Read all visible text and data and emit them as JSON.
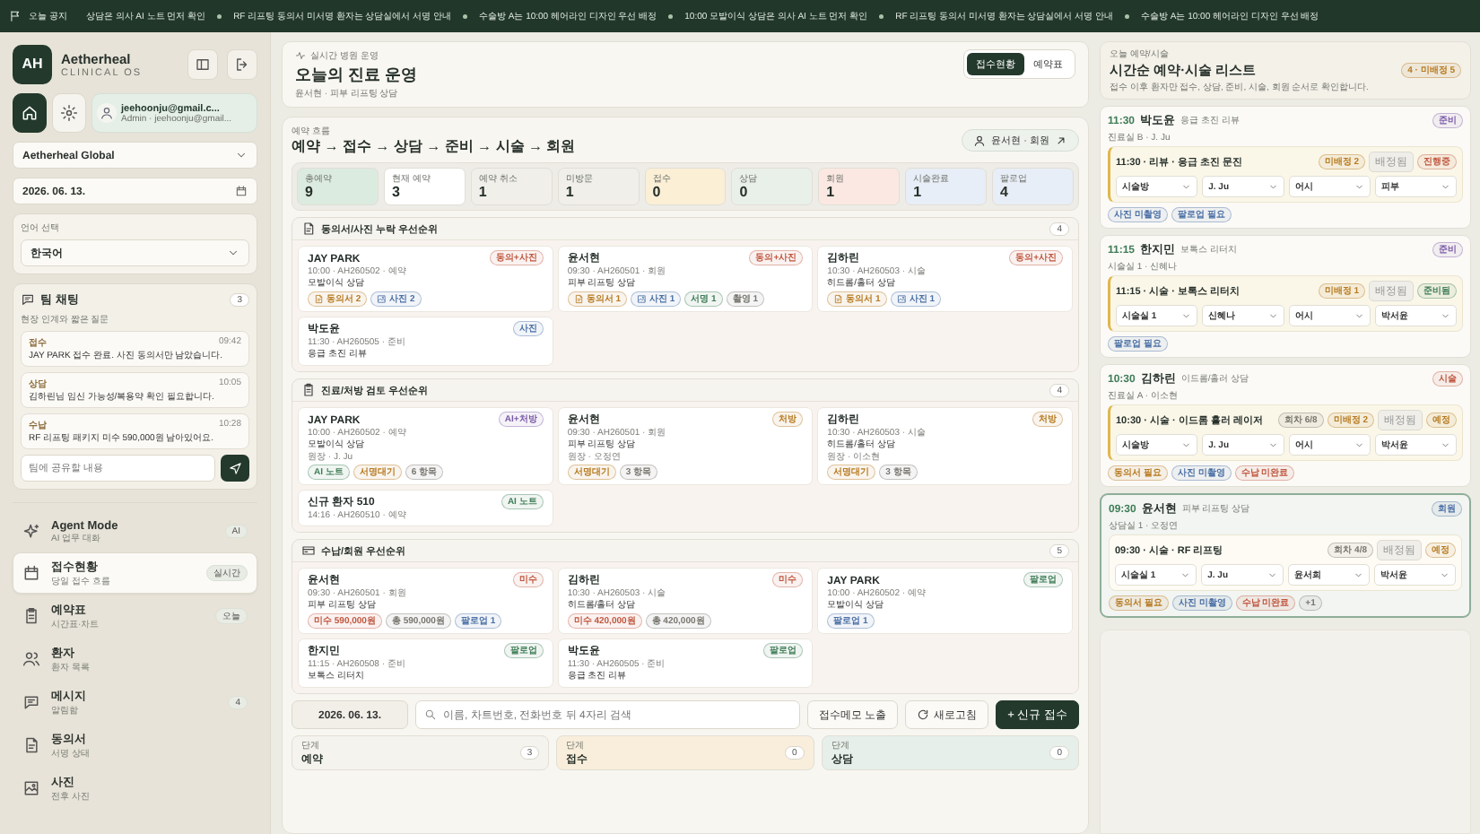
{
  "ticker": {
    "label": "오늘 공지",
    "items": [
      "상담은 의사 AI 노트 먼저 확인",
      "RF 리프팅 동의서 미서명 환자는 상담실에서 서명 안내",
      "수술방 A는 10:00 헤어라인 디자인 우선 배정",
      "10:00 모발이식 상담은 의사 AI 노트 먼저 확인",
      "RF 리프팅 동의서 미서명 환자는 상담실에서 서명 안내",
      "수술방 A는 10:00 헤어라인 디자인 우선 배정"
    ]
  },
  "sidebar": {
    "brand": {
      "mark": "AH",
      "name": "Aetherheal",
      "tagline": "CLINICAL OS"
    },
    "quick_buttons": [
      {
        "kind": "home",
        "selected": true
      },
      {
        "kind": "settings",
        "selected": false
      }
    ],
    "user": {
      "email": "jeehoonju@gmail.c...",
      "role": "Admin · jeehoonju@gmail..."
    },
    "clinic": "Aetherheal Global",
    "date": "2026. 06. 13.",
    "language": {
      "label": "언어 선택",
      "value": "한국어"
    },
    "team_chat": {
      "title": "팀 채팅",
      "count": "3",
      "subtitle": "현장 인계와 짧은 질문",
      "placeholder": "팀에 공유할 내용",
      "messages": [
        {
          "role": "접수",
          "time": "09:42",
          "text": "JAY PARK 접수 완료. 사진 동의서만 남았습니다."
        },
        {
          "role": "상담",
          "time": "10:05",
          "text": "김하린님 임신 가능성/복용약 확인 필요합니다."
        },
        {
          "role": "수납",
          "time": "10:28",
          "text": "RF 리프팅 패키지 미수 590,000원 남아있어요."
        }
      ]
    },
    "nav": [
      {
        "kind": "agent",
        "title": "Agent Mode",
        "subtitle": "AI 업무 대화",
        "badge": "AI",
        "selected": false
      },
      {
        "kind": "reception",
        "title": "접수현황",
        "subtitle": "당일 접수 흐름",
        "badge": "실시간",
        "selected": true
      },
      {
        "kind": "schedule",
        "title": "예약표",
        "subtitle": "시간표·차트",
        "badge": "오늘",
        "selected": false
      },
      {
        "kind": "patients",
        "title": "환자",
        "subtitle": "환자 목록",
        "selected": false
      },
      {
        "kind": "messages",
        "title": "메시지",
        "subtitle": "알림함",
        "badge": "4",
        "selected": false
      },
      {
        "kind": "consent",
        "title": "동의서",
        "subtitle": "서명 상태",
        "selected": false
      },
      {
        "kind": "photos",
        "title": "사진",
        "subtitle": "전후 사진",
        "selected": false
      }
    ]
  },
  "main": {
    "header": {
      "eyebrow": "실시간 병원 운영",
      "title": "오늘의 진료 운영",
      "subtitle": "윤서현 · 피부 리프팅 상담",
      "views": [
        {
          "label": "접수현황",
          "selected": true
        },
        {
          "label": "예약표",
          "selected": false
        }
      ]
    },
    "flow": {
      "eyebrow": "예약 흐름",
      "title": "예약 → 접수 → 상담 → 준비 → 시술 → 회원",
      "action": "윤서현 · 회원",
      "stats": [
        {
          "label": "총예약",
          "value": "9",
          "color": "#dcebdf"
        },
        {
          "label": "현재 예약",
          "value": "3",
          "color": "#ffffff"
        },
        {
          "label": "예약 취소",
          "value": "1",
          "color": "#f0efea"
        },
        {
          "label": "미방문",
          "value": "1",
          "color": "#f0efea"
        },
        {
          "label": "접수",
          "value": "0",
          "color": "#fbefd6"
        },
        {
          "label": "상담",
          "value": "0",
          "color": "#e9efe9"
        },
        {
          "label": "회원",
          "value": "1",
          "color": "#fbe8e2"
        },
        {
          "label": "시술완료",
          "value": "1",
          "color": "#e8eef7"
        },
        {
          "label": "팔로업",
          "value": "4",
          "color": "#e8eef7"
        }
      ]
    },
    "sections": [
      {
        "kind": "consent",
        "title": "동의서/사진 누락 우선순위",
        "count": "4",
        "cards": [
          {
            "name": "JAY PARK",
            "tag": {
              "text": "동의+사진",
              "color": "#c0563f"
            },
            "meta": "10:00 · AH260502 · 예약",
            "service": "모발이식 상담",
            "chips": [
              {
                "kind": "document",
                "text": "동의서 2",
                "color": "#b7791f"
              },
              {
                "kind": "photo",
                "text": "사진 2",
                "color": "#4a6fa5"
              }
            ]
          },
          {
            "name": "윤서현",
            "tag": {
              "text": "동의+사진",
              "color": "#c0563f"
            },
            "meta": "09:30 · AH260501 · 회원",
            "service": "피부 리프팅 상담",
            "chips": [
              {
                "kind": "document",
                "text": "동의서 1",
                "color": "#b7791f"
              },
              {
                "kind": "photo",
                "text": "사진 1",
                "color": "#4a6fa5"
              },
              {
                "kind": "plain",
                "text": "서명 1",
                "color": "#3f7d57"
              },
              {
                "kind": "plain",
                "text": "촬영 1",
                "color": "#77756d"
              }
            ]
          },
          {
            "name": "김하린",
            "tag": {
              "text": "동의+사진",
              "color": "#c0563f"
            },
            "meta": "10:30 · AH260503 · 시술",
            "service": "히드롬/홀터 상담",
            "chips": [
              {
                "kind": "document",
                "text": "동의서 1",
                "color": "#b7791f"
              },
              {
                "kind": "photo",
                "text": "사진 1",
                "color": "#4a6fa5"
              }
            ]
          },
          {
            "name": "박도윤",
            "tag": {
              "text": "사진",
              "color": "#4a6fa5"
            },
            "meta": "11:30 · AH260505 · 준비",
            "service": "응급 초진 리뷰"
          }
        ]
      },
      {
        "kind": "review",
        "title": "진료/처방 검토 우선순위",
        "count": "4",
        "cards": [
          {
            "name": "JAY PARK",
            "tag": {
              "text": "AI+처방",
              "color": "#7a5aa6"
            },
            "meta": "10:00 · AH260502 · 예약",
            "service": "모발이식 상담",
            "doctor": "원장 · J. Ju",
            "chips": [
              {
                "kind": "plain",
                "text": "AI 노트",
                "color": "#3f7d57"
              },
              {
                "kind": "plain",
                "text": "서명대기",
                "color": "#b7791f"
              },
              {
                "kind": "plain",
                "text": "6 항목",
                "color": "#77756d"
              }
            ]
          },
          {
            "name": "윤서현",
            "tag": {
              "text": "처방",
              "color": "#b7791f"
            },
            "meta": "09:30 · AH260501 · 회원",
            "service": "피부 리프팅 상담",
            "doctor": "원장 · 오정연",
            "chips": [
              {
                "kind": "plain",
                "text": "서명대기",
                "color": "#b7791f"
              },
              {
                "kind": "plain",
                "text": "3 항목",
                "color": "#77756d"
              }
            ]
          },
          {
            "name": "김하린",
            "tag": {
              "text": "처방",
              "color": "#b7791f"
            },
            "meta": "10:30 · AH260503 · 시술",
            "service": "히드롬/홀터 상담",
            "doctor": "원장 · 이소현",
            "chips": [
              {
                "kind": "plain",
                "text": "서명대기",
                "color": "#b7791f"
              },
              {
                "kind": "plain",
                "text": "3 항목",
                "color": "#77756d"
              }
            ]
          },
          {
            "name": "신규 환자 510",
            "tag": {
              "text": "AI 노트",
              "color": "#3f7d57"
            },
            "meta": "14:16 · AH260510 · 예약"
          }
        ]
      },
      {
        "kind": "payment",
        "title": "수납/회원 우선순위",
        "count": "5",
        "cards": [
          {
            "name": "윤서현",
            "tag": {
              "text": "미수",
              "color": "#c0563f"
            },
            "meta": "09:30 · AH260501 · 회원",
            "service": "피부 리프팅 상담",
            "chips": [
              {
                "kind": "plain",
                "text": "미수 590,000원",
                "color": "#c0563f"
              },
              {
                "kind": "plain",
                "text": "총 590,000원",
                "color": "#77756d"
              },
              {
                "kind": "plain",
                "text": "팔로업 1",
                "color": "#4a6fa5"
              }
            ]
          },
          {
            "name": "김하린",
            "tag": {
              "text": "미수",
              "color": "#c0563f"
            },
            "meta": "10:30 · AH260503 · 시술",
            "service": "히드롬/홀터 상담",
            "chips": [
              {
                "kind": "plain",
                "text": "미수 420,000원",
                "color": "#c0563f"
              },
              {
                "kind": "plain",
                "text": "총 420,000원",
                "color": "#77756d"
              }
            ]
          },
          {
            "name": "JAY PARK",
            "tag": {
              "text": "팔로업",
              "color": "#3f7d57"
            },
            "meta": "10:00 · AH260502 · 예약",
            "service": "모발이식 상담",
            "chips": [
              {
                "kind": "plain",
                "text": "팔로업 1",
                "color": "#4a6fa5"
              }
            ]
          },
          {
            "name": "한지민",
            "tag": {
              "text": "팔로업",
              "color": "#3f7d57"
            },
            "meta": "11:15 · AH260508 · 준비",
            "service": "보톡스 리터치"
          },
          {
            "name": "박도윤",
            "tag": {
              "text": "팔로업",
              "color": "#3f7d57"
            },
            "meta": "11:30 · AH260505 · 준비",
            "service": "응급 초진 리뷰"
          }
        ]
      }
    ],
    "toolbar": {
      "date": "2026. 06. 13.",
      "search_placeholder": "이름, 차트번호, 전화번호 뒤 4자리 검색",
      "memo_button": "접수메모 노출",
      "refresh_button": "새로고침",
      "new_button": "+ 신규 접수"
    },
    "stages": [
      {
        "label": "단계",
        "name": "예약",
        "count": "3",
        "color": "#f4f3ee"
      },
      {
        "label": "단계",
        "name": "접수",
        "count": "0",
        "color": "#f8eedb"
      },
      {
        "label": "단계",
        "name": "상담",
        "count": "0",
        "color": "#e6efea"
      }
    ]
  },
  "schedule": {
    "eyebrow": "오늘 예약/시술",
    "title": "시간순 예약·시술 리스트",
    "badge": "4 · 미배정 5",
    "subtitle": "접수 이후 환자만 접수, 상담, 준비, 시술, 회원 순서로 확인합니다.",
    "entries": [
      {
        "time": "11:30",
        "name": "박도윤",
        "service": "응급 초진 리뷰",
        "status": {
          "text": "준비",
          "color": "#7a5aa6"
        },
        "room": "진료실 B · J. Ju",
        "selected": false,
        "block": {
          "title": "11:30 · 리뷰 · 응급 초진 문진",
          "highlighted": true,
          "chips": [
            {
              "text": "미배정 2",
              "color": "#b7791f"
            }
          ],
          "assigned": "배정됨",
          "state": {
            "text": "진행중",
            "color": "#c0563f"
          },
          "selects": [
            "시술방",
            "J. Ju",
            "어시",
            "피부"
          ]
        },
        "tags": [
          {
            "text": "사진 미촬영",
            "color": "#4a6fa5"
          },
          {
            "text": "팔로업 필요",
            "color": "#4a6fa5"
          }
        ]
      },
      {
        "time": "11:15",
        "name": "한지민",
        "service": "보톡스 리터치",
        "status": {
          "text": "준비",
          "color": "#7a5aa6"
        },
        "room": "시술실 1 · 신혜나",
        "selected": false,
        "block": {
          "title": "11:15 · 시술 · 보톡스 리터치",
          "highlighted": true,
          "chips": [
            {
              "text": "미배정 1",
              "color": "#b7791f"
            }
          ],
          "assigned": "배정됨",
          "state": {
            "text": "준비됨",
            "color": "#3f7d57"
          },
          "selects": [
            "시술실 1",
            "신혜나",
            "어시",
            "박서윤"
          ]
        },
        "tags": [
          {
            "text": "팔로업 필요",
            "color": "#4a6fa5"
          }
        ]
      },
      {
        "time": "10:30",
        "name": "김하린",
        "service": "이드롬/홀러 상담",
        "status": {
          "text": "시술",
          "color": "#c0563f"
        },
        "room": "진료실 A · 이소현",
        "selected": false,
        "block": {
          "title": "10:30 · 시술 · 이드롬 홀러 레이저",
          "highlighted": true,
          "chips": [
            {
              "text": "회차 6/8",
              "color": "#77756d"
            },
            {
              "text": "미배정 2",
              "color": "#b7791f"
            }
          ],
          "assigned": "배정됨",
          "state": {
            "text": "예정",
            "color": "#b7791f"
          },
          "selects": [
            "시술방",
            "J. Ju",
            "어시",
            "박서윤"
          ]
        },
        "tags": [
          {
            "text": "동의서 필요",
            "color": "#b7791f"
          },
          {
            "text": "사진 미촬영",
            "color": "#4a6fa5"
          },
          {
            "text": "수납 미완료",
            "color": "#c0563f"
          }
        ]
      },
      {
        "time": "09:30",
        "name": "윤서현",
        "service": "피부 리프팅 상담",
        "status": {
          "text": "회원",
          "color": "#4a6fa5"
        },
        "room": "상담실 1 · 오정연",
        "selected": true,
        "block": {
          "title": "09:30 · 시술 · RF 리프팅",
          "highlighted": false,
          "chips": [
            {
              "text": "회차 4/8",
              "color": "#77756d"
            }
          ],
          "assigned": "배정됨",
          "state": {
            "text": "예정",
            "color": "#b7791f"
          },
          "selects": [
            "시술실 1",
            "J. Ju",
            "윤서희",
            "박서윤"
          ]
        },
        "tags": [
          {
            "text": "동의서 필요",
            "color": "#b7791f"
          },
          {
            "text": "사진 미촬영",
            "color": "#4a6fa5"
          },
          {
            "text": "수납 미완료",
            "color": "#c0563f"
          },
          {
            "text": "+1",
            "color": "#77756d"
          }
        ]
      }
    ]
  }
}
